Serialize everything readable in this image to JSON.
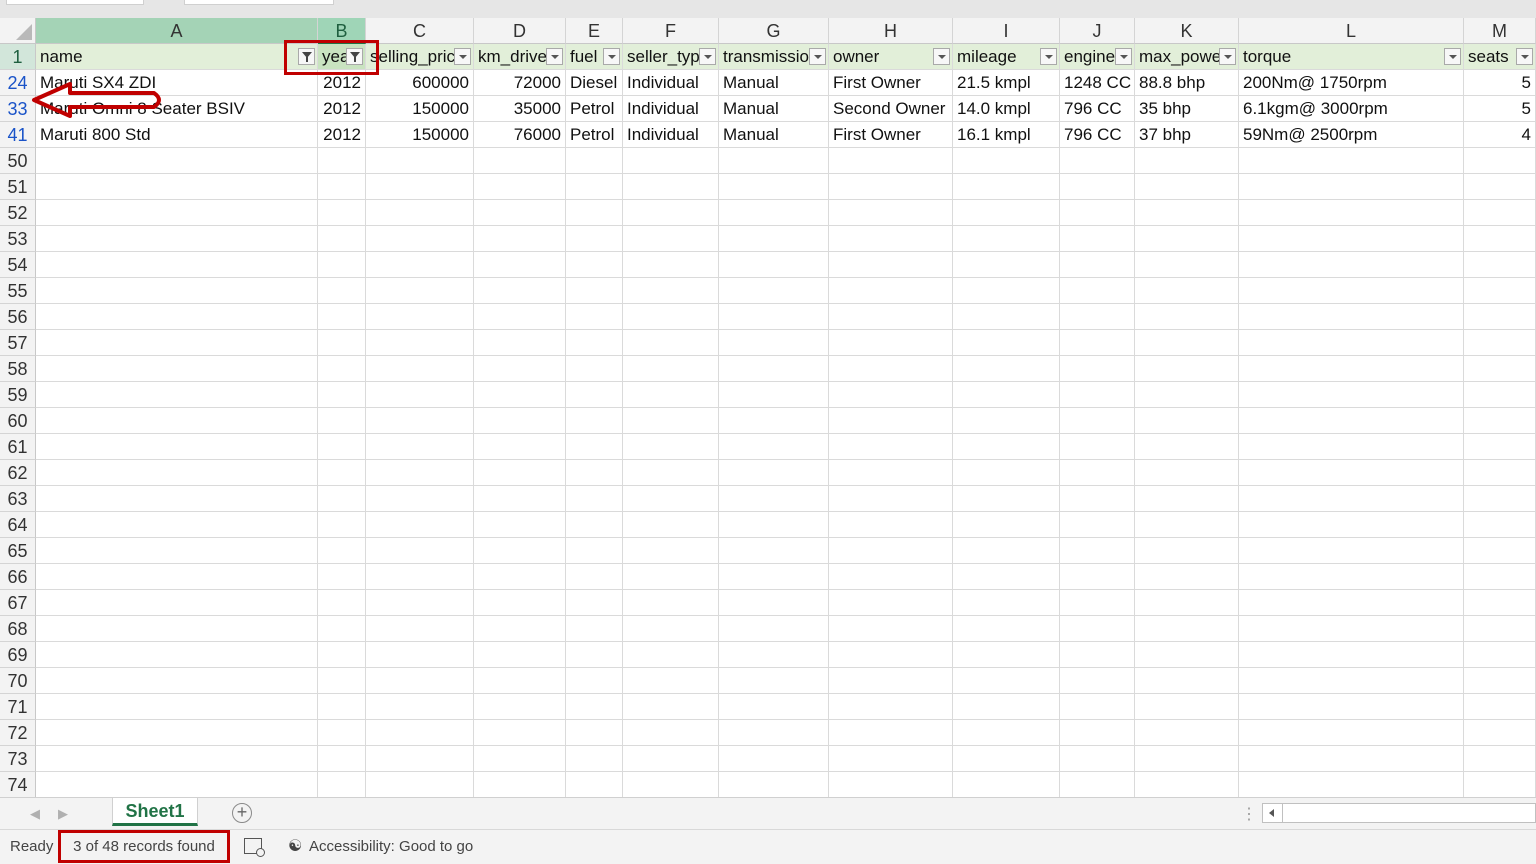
{
  "columns": [
    "A",
    "B",
    "C",
    "D",
    "E",
    "F",
    "G",
    "H",
    "I",
    "J",
    "K",
    "L",
    "M"
  ],
  "selected_column": "B",
  "header_row_number": "1",
  "headers": [
    "name",
    "year",
    "selling_price",
    "km_driven",
    "fuel",
    "seller_type",
    "transmission",
    "owner",
    "mileage",
    "engine",
    "max_power",
    "torque",
    "seats"
  ],
  "data_rows": [
    {
      "row": "24",
      "cells": [
        "Maruti SX4 ZDI",
        "2012",
        "600000",
        "72000",
        "Diesel",
        "Individual",
        "Manual",
        "First Owner",
        "21.5 kmpl",
        "1248 CC",
        "88.8 bhp",
        "200Nm@ 1750rpm",
        "5"
      ]
    },
    {
      "row": "33",
      "cells": [
        "Maruti Omni 8 Seater BSIV",
        "2012",
        "150000",
        "35000",
        "Petrol",
        "Individual",
        "Manual",
        "Second Owner",
        "14.0 kmpl",
        "796 CC",
        "35 bhp",
        "6.1kgm@ 3000rpm",
        "5"
      ]
    },
    {
      "row": "41",
      "cells": [
        "Maruti 800 Std",
        "2012",
        "150000",
        "76000",
        "Petrol",
        "Individual",
        "Manual",
        "First Owner",
        "16.1 kmpl",
        "796 CC",
        "37 bhp",
        "59Nm@ 2500rpm",
        "4"
      ]
    }
  ],
  "empty_rows": [
    "50",
    "51",
    "52",
    "53",
    "54",
    "55",
    "56",
    "57",
    "58",
    "59",
    "60",
    "61",
    "62",
    "63",
    "64",
    "65",
    "66",
    "67",
    "68",
    "69",
    "70",
    "71",
    "72",
    "73",
    "74"
  ],
  "sheet_tab": "Sheet1",
  "status": {
    "ready": "Ready",
    "records": "3 of 48 records found",
    "accessibility": "Accessibility: Good to go"
  },
  "colors": {
    "accent_green": "#217346",
    "annotation_red": "#c00000",
    "filtered_row_blue": "#1a53c8"
  }
}
